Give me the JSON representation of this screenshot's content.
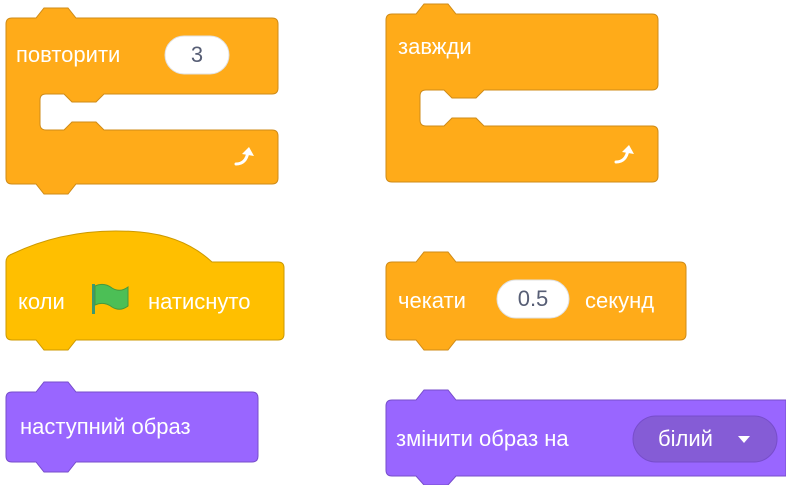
{
  "colors": {
    "control": "#FFAB19",
    "control_stroke": "#CF8B17",
    "events": "#FFBF00",
    "events_stroke": "#CC9900",
    "looks": "#9966FF",
    "looks_stroke": "#774DCB",
    "looks_dark": "#855CD6",
    "flag": "#4CBF56",
    "input_text": "#575E75"
  },
  "blocks": {
    "repeat": {
      "label": "повторити",
      "count": "3",
      "arrow_icon": "loop-arrow-icon"
    },
    "forever": {
      "label": "завжди",
      "arrow_icon": "loop-arrow-icon"
    },
    "when_flag": {
      "label_before": "коли",
      "label_after": "натиснуто",
      "icon": "green-flag-icon"
    },
    "wait": {
      "label_before": "чекати",
      "value": "0.5",
      "label_after": "секунд"
    },
    "next_costume": {
      "label": "наступний образ"
    },
    "switch_costume": {
      "label": "змінити образ на",
      "value": "білий",
      "dropdown_icon": "dropdown-arrow-icon"
    }
  }
}
